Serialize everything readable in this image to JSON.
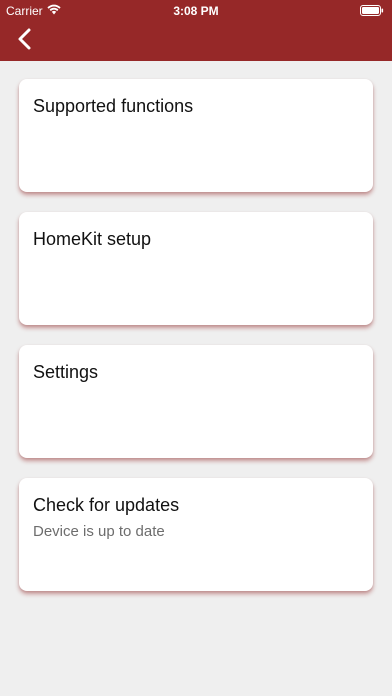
{
  "status_bar": {
    "carrier": "Carrier",
    "time": "3:08 PM",
    "icons": [
      "wifi-icon",
      "battery-icon"
    ]
  },
  "nav": {
    "back_icon": "chevron-left-icon"
  },
  "colors": {
    "header_bg": "#962828",
    "page_bg": "#efefef",
    "card_bg": "#ffffff",
    "subtitle": "#6d6d6d"
  },
  "cards": [
    {
      "title": "Supported functions",
      "subtitle": ""
    },
    {
      "title": "HomeKit setup",
      "subtitle": ""
    },
    {
      "title": "Settings",
      "subtitle": ""
    },
    {
      "title": "Check for updates",
      "subtitle": "Device is up to date"
    }
  ]
}
